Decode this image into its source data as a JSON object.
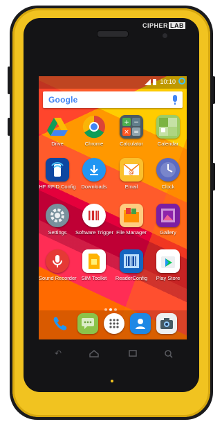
{
  "device": {
    "brand": "CIPHER",
    "brand_suffix": "LAB"
  },
  "status_bar": {
    "time": "10:10"
  },
  "search": {
    "logo": "Google"
  },
  "apps": [
    {
      "label": "Drive",
      "icon": "drive-icon",
      "color": "#1fa463"
    },
    {
      "label": "Chrome",
      "icon": "chrome-icon",
      "color": "#db4437"
    },
    {
      "label": "Calculator",
      "icon": "calculator-icon",
      "color": "#607d8b"
    },
    {
      "label": "Calendar",
      "icon": "calendar-icon",
      "color": "#8bc34a"
    },
    {
      "label": "HF RFID Config",
      "icon": "rfid-config-icon",
      "color": "#1e88e5"
    },
    {
      "label": "Downloads",
      "icon": "downloads-icon",
      "color": "#2196f3"
    },
    {
      "label": "Email",
      "icon": "email-icon",
      "color": "#fbc02d"
    },
    {
      "label": "Clock",
      "icon": "clock-icon",
      "color": "#5c6bc0"
    },
    {
      "label": "Settings",
      "icon": "settings-icon",
      "color": "#607d8b"
    },
    {
      "label": "Software Trigger",
      "icon": "software-trigger-icon",
      "color": "#ffffff"
    },
    {
      "label": "File Manager",
      "icon": "file-manager-icon",
      "color": "#ff7043"
    },
    {
      "label": "Gallery",
      "icon": "gallery-icon",
      "color": "#9c27b0"
    },
    {
      "label": "Sound Recorder",
      "icon": "sound-recorder-icon",
      "color": "#e53935"
    },
    {
      "label": "SIM Toolkit",
      "icon": "sim-toolkit-icon",
      "color": "#ffffff"
    },
    {
      "label": "ReaderConfig",
      "icon": "reader-config-icon",
      "color": "#1565c0"
    },
    {
      "label": "Play Store",
      "icon": "play-store-icon",
      "color": "#ffffff"
    }
  ],
  "dock": [
    {
      "icon": "phone-icon",
      "color": "#2196f3"
    },
    {
      "icon": "messaging-icon",
      "color": "#8bc34a"
    },
    {
      "icon": "app-drawer-icon",
      "color": "#ffffff"
    },
    {
      "icon": "contacts-icon",
      "color": "#1e88e5"
    },
    {
      "icon": "camera-icon",
      "color": "#eceff1"
    }
  ],
  "navbar": {
    "buttons": [
      "back-icon",
      "home-icon",
      "recents-icon",
      "search-icon"
    ]
  }
}
